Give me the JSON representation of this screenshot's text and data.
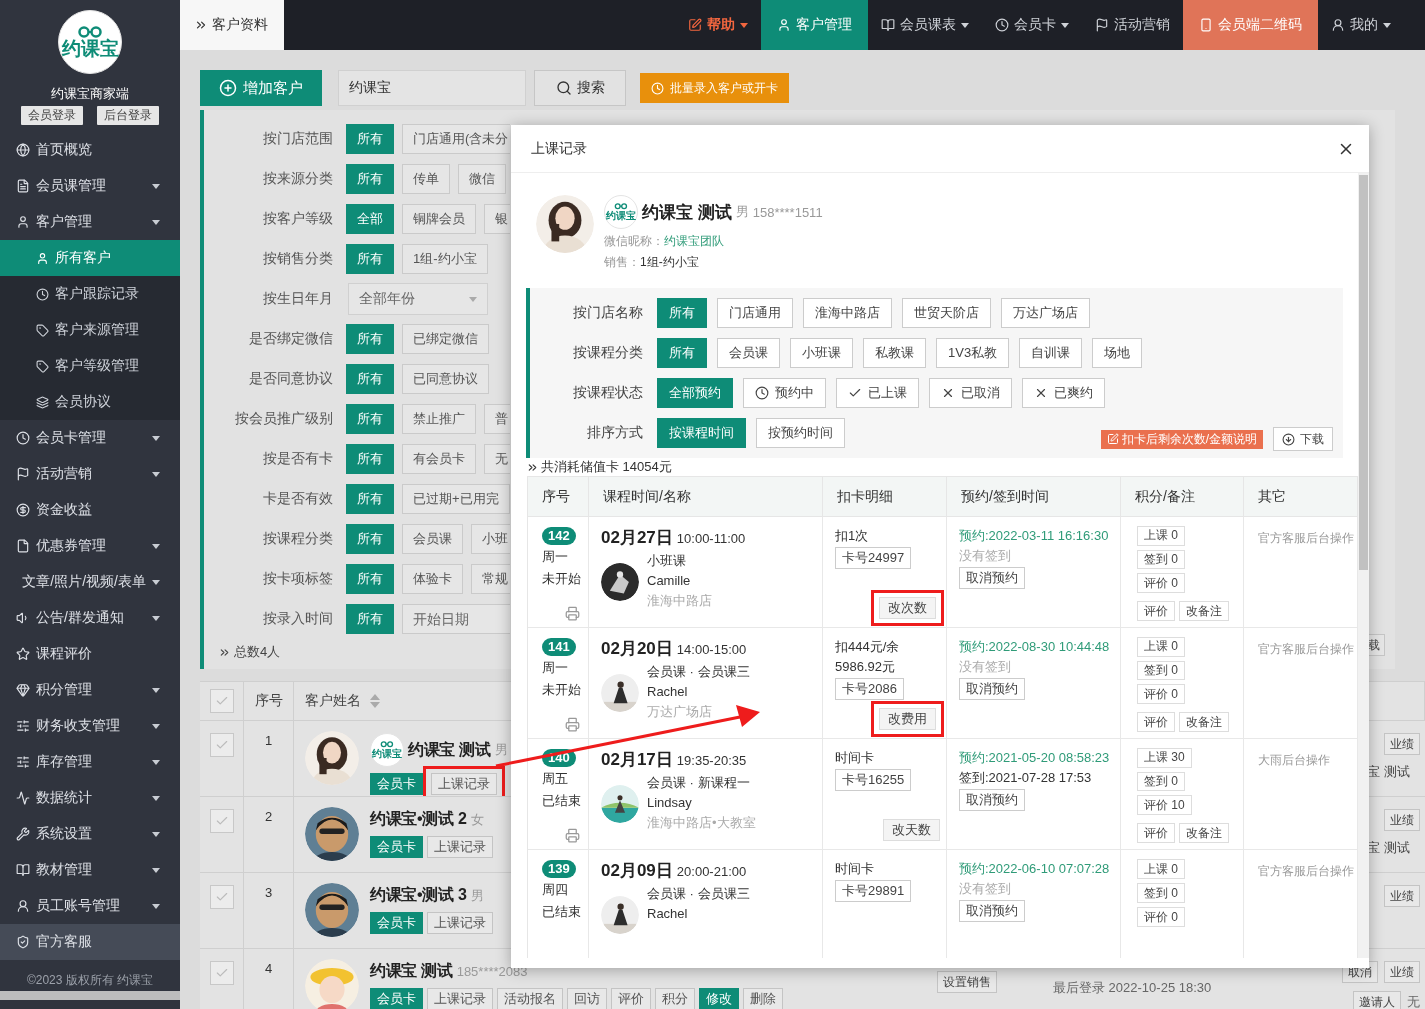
{
  "sidebar": {
    "logo": "约课宝",
    "title": "约课宝商家端",
    "buttons": [
      "会员登录",
      "后台登录"
    ],
    "items": [
      {
        "label": "首页概览",
        "caret": false,
        "highlighted": false
      },
      {
        "label": "会员课管理",
        "caret": true,
        "highlighted": false
      },
      {
        "label": "客户管理",
        "caret": true,
        "highlighted": false,
        "expanded": true,
        "children": [
          {
            "label": "所有客户",
            "selected": true
          },
          {
            "label": "客户跟踪记录",
            "selected": false
          },
          {
            "label": "客户来源管理",
            "selected": false
          },
          {
            "label": "客户等级管理",
            "selected": false
          },
          {
            "label": "会员协议",
            "selected": false
          }
        ]
      },
      {
        "label": "会员卡管理",
        "caret": true,
        "highlighted": false
      },
      {
        "label": "活动营销",
        "caret": true,
        "highlighted": false
      },
      {
        "label": "资金收益",
        "caret": false,
        "highlighted": false
      },
      {
        "label": "优惠券管理",
        "caret": true,
        "highlighted": false
      },
      {
        "label": "文章/照片/视频/表单",
        "caret": true,
        "highlighted": false
      },
      {
        "label": "公告/群发通知",
        "caret": true,
        "highlighted": false
      },
      {
        "label": "课程评价",
        "caret": false,
        "highlighted": false
      },
      {
        "label": "积分管理",
        "caret": true,
        "highlighted": false
      },
      {
        "label": "财务收支管理",
        "caret": true,
        "highlighted": false
      },
      {
        "label": "库存管理",
        "caret": true,
        "highlighted": false
      },
      {
        "label": "数据统计",
        "caret": true,
        "highlighted": false
      },
      {
        "label": "系统设置",
        "caret": true,
        "highlighted": false
      },
      {
        "label": "教材管理",
        "caret": true,
        "highlighted": false
      },
      {
        "label": "员工账号管理",
        "caret": true,
        "highlighted": false
      },
      {
        "label": "官方客服",
        "caret": false,
        "highlighted": true
      }
    ],
    "footer": "©2023 版权所有 约课宝"
  },
  "topbar": {
    "crumb": "客户资料",
    "menus": [
      {
        "label": "帮助",
        "kind": "help",
        "caret": true
      },
      {
        "label": "客户管理",
        "kind": "active",
        "caret": false
      },
      {
        "label": "会员课表",
        "kind": "normal",
        "caret": true
      },
      {
        "label": "会员卡",
        "kind": "normal",
        "caret": true
      },
      {
        "label": "活动营销",
        "kind": "normal",
        "caret": false
      },
      {
        "label": "会员端二维码",
        "kind": "accent",
        "caret": false
      },
      {
        "label": "我的",
        "kind": "normal",
        "caret": true
      }
    ]
  },
  "toolbar": {
    "add_button": "增加客户",
    "search_value": "约课宝",
    "search_button": "搜索",
    "import_button": "批量录入客户或开卡"
  },
  "filters": [
    {
      "label": "按门店范围",
      "kind": "buttons",
      "options": [
        {
          "label": "所有",
          "selected": true
        },
        {
          "label": "门店通用(含未分",
          "selected": false
        }
      ]
    },
    {
      "label": "按来源分类",
      "kind": "buttons",
      "options": [
        {
          "label": "所有",
          "selected": true
        },
        {
          "label": "传单",
          "selected": false
        },
        {
          "label": "微信",
          "selected": false
        }
      ]
    },
    {
      "label": "按客户等级",
      "kind": "buttons",
      "options": [
        {
          "label": "全部",
          "selected": true
        },
        {
          "label": "铜牌会员",
          "selected": false
        },
        {
          "label": "银",
          "selected": false
        }
      ]
    },
    {
      "label": "按销售分类",
      "kind": "buttons",
      "options": [
        {
          "label": "所有",
          "selected": true
        },
        {
          "label": "1组-约小宝",
          "selected": false
        }
      ]
    },
    {
      "label": "按生日年月",
      "kind": "select",
      "value": "全部年份"
    },
    {
      "label": "是否绑定微信",
      "kind": "buttons",
      "options": [
        {
          "label": "所有",
          "selected": true
        },
        {
          "label": "已绑定微信",
          "selected": false
        }
      ]
    },
    {
      "label": "是否同意协议",
      "kind": "buttons",
      "options": [
        {
          "label": "所有",
          "selected": true
        },
        {
          "label": "已同意协议",
          "selected": false
        }
      ]
    },
    {
      "label": "按会员推广级别",
      "kind": "buttons",
      "options": [
        {
          "label": "所有",
          "selected": true
        },
        {
          "label": "禁止推广",
          "selected": false
        },
        {
          "label": "普",
          "selected": false
        }
      ]
    },
    {
      "label": "按是否有卡",
      "kind": "buttons",
      "options": [
        {
          "label": "所有",
          "selected": true
        },
        {
          "label": "有会员卡",
          "selected": false
        },
        {
          "label": "无",
          "selected": false
        }
      ]
    },
    {
      "label": "卡是否有效",
      "kind": "buttons",
      "options": [
        {
          "label": "所有",
          "selected": true
        },
        {
          "label": "已过期+已用完",
          "selected": false
        }
      ]
    },
    {
      "label": "按课程分类",
      "kind": "buttons",
      "options": [
        {
          "label": "所有",
          "selected": true
        },
        {
          "label": "会员课",
          "selected": false
        },
        {
          "label": "小班",
          "selected": false
        }
      ]
    },
    {
      "label": "按卡项标签",
      "kind": "buttons",
      "options": [
        {
          "label": "所有",
          "selected": true
        },
        {
          "label": "体验卡",
          "selected": false
        },
        {
          "label": "常规",
          "selected": false
        }
      ]
    },
    {
      "label": "按录入时间",
      "kind": "date",
      "options": [
        {
          "label": "所有",
          "selected": true
        }
      ],
      "placeholder": "开始日期"
    }
  ],
  "filter_summary": "总数4人",
  "filter_fragment": "载",
  "customer_table": {
    "columns": [
      "序号",
      "客户姓名"
    ],
    "all_checked": false,
    "rows": [
      {
        "index": "1",
        "checked": false,
        "badge": "约课宝",
        "name": "约课宝 测试",
        "info": "男",
        "tags": [
          {
            "label": "会员卡",
            "kind": "card",
            "highlighted": false
          },
          {
            "label": "上课记录",
            "kind": "plain",
            "highlighted": true
          }
        ],
        "right_buttons": [
          "业绩"
        ],
        "right_text": "宝 测试"
      },
      {
        "index": "2",
        "checked": false,
        "name": "约课宝•测试 2",
        "info": "女",
        "tags": [
          {
            "label": "会员卡",
            "kind": "card",
            "highlighted": false
          },
          {
            "label": "上课记录",
            "kind": "plain",
            "highlighted": false
          }
        ],
        "right_buttons": [
          "业绩"
        ],
        "right_text": "宝 测试"
      },
      {
        "index": "3",
        "checked": false,
        "name": "约课宝•测试 3",
        "info": "男",
        "tags": [
          {
            "label": "会员卡",
            "kind": "card",
            "highlighted": false
          },
          {
            "label": "上课记录",
            "kind": "plain",
            "highlighted": false
          }
        ],
        "right_buttons": [
          "业绩"
        ]
      },
      {
        "index": "4",
        "checked": false,
        "name": "约课宝 测试",
        "info": "185****2083",
        "tags": [
          {
            "label": "会员卡",
            "kind": "card",
            "highlighted": false
          },
          {
            "label": "上课记录",
            "kind": "plain",
            "highlighted": false
          },
          {
            "label": "活动报名",
            "kind": "plain",
            "highlighted": false
          },
          {
            "label": "回访",
            "kind": "plain",
            "highlighted": false
          },
          {
            "label": "评价",
            "kind": "plain",
            "highlighted": false
          },
          {
            "label": "积分",
            "kind": "plain",
            "highlighted": false
          },
          {
            "label": "修改",
            "kind": "edit",
            "highlighted": false
          },
          {
            "label": "删除",
            "kind": "plain",
            "highlighted": false
          }
        ],
        "sales_button": "设置销售",
        "login": "最后登录 2022-10-25 18:30",
        "right_buttons": [
          "取消",
          "业绩"
        ],
        "invite_button": "邀请人",
        "invite_text": "无"
      }
    ]
  },
  "modal": {
    "title": "上课记录",
    "profile": {
      "badge": "约课宝",
      "name": "约课宝 测试",
      "gender": "男",
      "phone": "158****1511",
      "wechat_label": "微信昵称：",
      "wechat": "约课宝团队",
      "sales_label": "销售：",
      "sales": "1组-约小宝"
    },
    "filters": [
      {
        "label": "按门店名称",
        "options": [
          {
            "label": "所有",
            "selected": true,
            "kind": "plain"
          },
          {
            "label": "门店通用",
            "selected": false,
            "kind": "plain"
          },
          {
            "label": "淮海中路店",
            "selected": false,
            "kind": "plain"
          },
          {
            "label": "世贸天阶店",
            "selected": false,
            "kind": "plain"
          },
          {
            "label": "万达广场店",
            "selected": false,
            "kind": "plain"
          }
        ]
      },
      {
        "label": "按课程分类",
        "options": [
          {
            "label": "所有",
            "selected": true,
            "kind": "plain"
          },
          {
            "label": "会员课",
            "selected": false,
            "kind": "plain"
          },
          {
            "label": "小班课",
            "selected": false,
            "kind": "plain"
          },
          {
            "label": "私教课",
            "selected": false,
            "kind": "plain"
          },
          {
            "label": "1V3私教",
            "selected": false,
            "kind": "plain"
          },
          {
            "label": "自训课",
            "selected": false,
            "kind": "plain"
          },
          {
            "label": "场地",
            "selected": false,
            "kind": "plain"
          }
        ]
      },
      {
        "label": "按课程状态",
        "options": [
          {
            "label": "全部预约",
            "selected": true,
            "kind": "plain"
          },
          {
            "label": "预约中",
            "selected": false,
            "kind": "clock"
          },
          {
            "label": "已上课",
            "selected": false,
            "kind": "check"
          },
          {
            "label": "已取消",
            "selected": false,
            "kind": "cross"
          },
          {
            "label": "已爽约",
            "selected": false,
            "kind": "cross"
          }
        ]
      },
      {
        "label": "排序方式",
        "options": [
          {
            "label": "按课程时间",
            "selected": true,
            "kind": "plain"
          },
          {
            "label": "按预约时间",
            "selected": false,
            "kind": "plain"
          }
        ]
      }
    ],
    "note_button": "扣卡后剩余次数/金额说明",
    "download_button": "下载",
    "summary": "共消耗储值卡 14054元",
    "table": {
      "columns": [
        "序号",
        "课程时间/名称",
        "扣卡明细",
        "预约/签到时间",
        "积分/备注",
        "其它"
      ],
      "rows": [
        {
          "number": "142",
          "weekday": "周一",
          "status": "未开始",
          "date": "02月27日",
          "time": "10:00-11:00",
          "course": "小班课",
          "teacher": "Camille",
          "store": "淮海中路店",
          "deduct": [
            "扣1次"
          ],
          "card": "卡号24997",
          "edit": {
            "label": "改次数",
            "highlighted": true
          },
          "booking": "预约:2022-03-11 16:16:30",
          "signin": "没有签到",
          "signed": false,
          "cancel": "取消预约",
          "scores": [
            "上课 0",
            "签到 0",
            "评价 0"
          ],
          "actions": [
            "评价",
            "改备注"
          ],
          "other": "官方客服后台操作"
        },
        {
          "number": "141",
          "weekday": "周一",
          "status": "未开始",
          "date": "02月20日",
          "time": "14:00-15:00",
          "course": "会员课 · 会员课三",
          "teacher": "Rachel",
          "store": "万达广场店",
          "deduct": [
            "扣444元/余",
            "5986.92元"
          ],
          "card": "卡号2086",
          "edit": {
            "label": "改费用",
            "highlighted": true
          },
          "booking": "预约:2022-08-30 10:44:48",
          "signin": "没有签到",
          "signed": false,
          "cancel": "取消预约",
          "scores": [
            "上课 0",
            "签到 0",
            "评价 0"
          ],
          "actions": [
            "评价",
            "改备注"
          ],
          "other": "官方客服后台操作"
        },
        {
          "number": "140",
          "weekday": "周五",
          "status": "已结束",
          "date": "02月17日",
          "time": "19:35-20:35",
          "course": "会员课 · 新课程一",
          "teacher": "Lindsay",
          "store": "淮海中路店•大教室",
          "deduct": [
            "时间卡"
          ],
          "card": "卡号16255",
          "edit": {
            "label": "改天数",
            "highlighted": false
          },
          "booking": "预约:2021-05-20 08:58:23",
          "signin": "签到:2021-07-28 17:53",
          "signed": true,
          "cancel": "取消预约",
          "scores": [
            "上课 30",
            "签到 0",
            "评价 10"
          ],
          "actions": [
            "评价",
            "改备注"
          ],
          "other": "大雨后台操作"
        },
        {
          "number": "139",
          "weekday": "周四",
          "status": "已结束",
          "date": "02月09日",
          "time": "20:00-21:00",
          "course": "会员课 · 会员课三",
          "teacher": "Rachel",
          "deduct": [
            "时间卡"
          ],
          "card": "卡号29891",
          "booking": "预约:2022-06-10 07:07:28",
          "signin": "没有签到",
          "signed": false,
          "cancel": "取消预约",
          "scores": [
            "上课 0",
            "签到 0",
            "评价 0"
          ],
          "other": "官方客服后台操作"
        }
      ]
    }
  }
}
